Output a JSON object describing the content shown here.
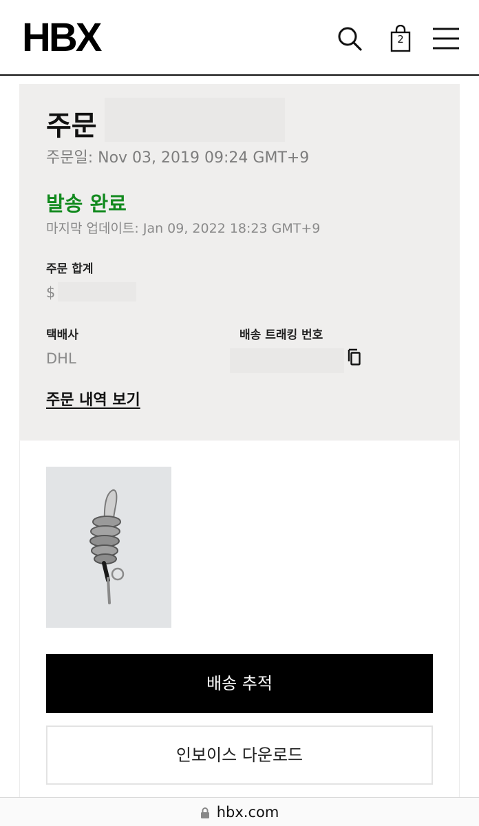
{
  "header": {
    "logo": "HBX",
    "bag_count": "2",
    "icons": {
      "search": "search-icon",
      "bag": "shopping-bag-icon",
      "menu": "hamburger-menu-icon"
    }
  },
  "order": {
    "title": "주문",
    "order_date": "주문일: Nov 03, 2019 09:24 GMT+9",
    "status": "발송 완료",
    "status_color": "#128a1e",
    "last_update": "마지막 업데이트: Jan 09, 2022 18:23 GMT+9",
    "total_label": "주문 합계",
    "total_value": "$",
    "carrier_label": "택배사",
    "carrier_value": "DHL",
    "tracking_label": "배송 트래킹 번호",
    "history_link": "주문 내역 보기"
  },
  "actions": {
    "track": "배송 추적",
    "invoice": "인보이스 다운로드"
  },
  "browser": {
    "url": "hbx.com"
  }
}
